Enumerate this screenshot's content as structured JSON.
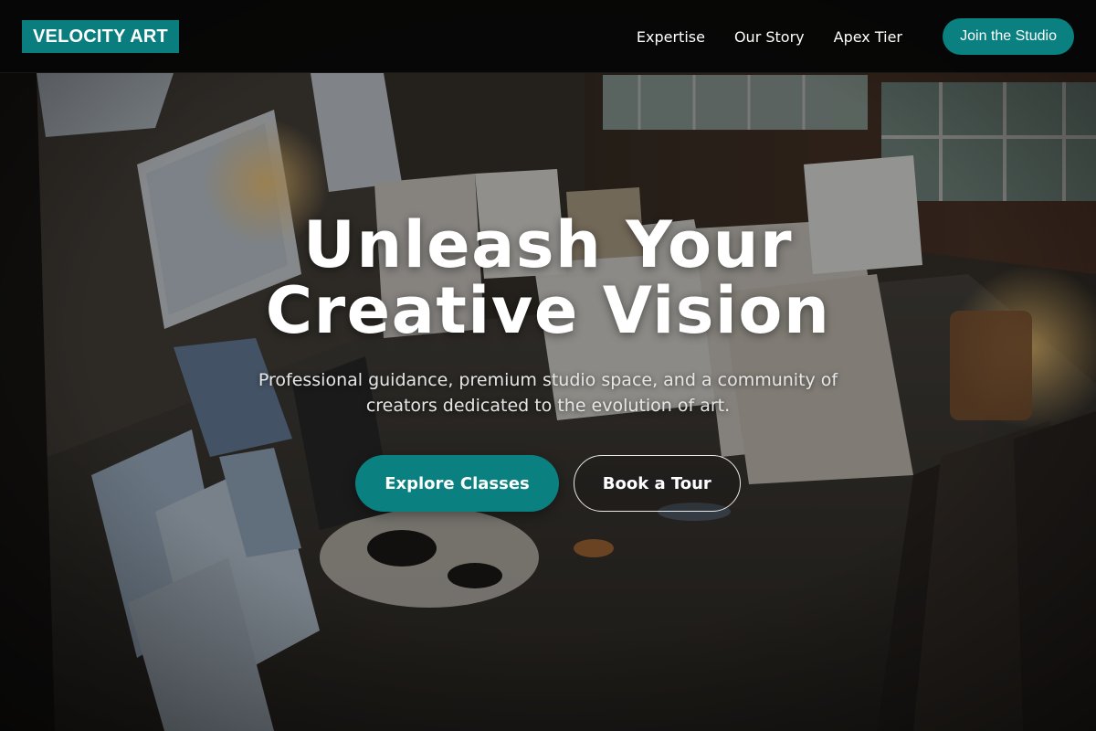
{
  "brand": {
    "name": "VELOCITY ART",
    "accent_color": "#0a8080"
  },
  "nav": {
    "links": [
      {
        "label": "Expertise"
      },
      {
        "label": "Our Story"
      },
      {
        "label": "Apex Tier"
      }
    ],
    "cta_label": "Join the Studio"
  },
  "hero": {
    "background_image": "art studio interior with canvases, brick walls and windows",
    "title_line1": "Unleash Your",
    "title_line2": "Creative Vision",
    "subtitle": "Professional guidance, premium studio space, and a community of creators dedicated to the evolution of art.",
    "primary_button": "Explore Classes",
    "secondary_button": "Book a Tour"
  }
}
